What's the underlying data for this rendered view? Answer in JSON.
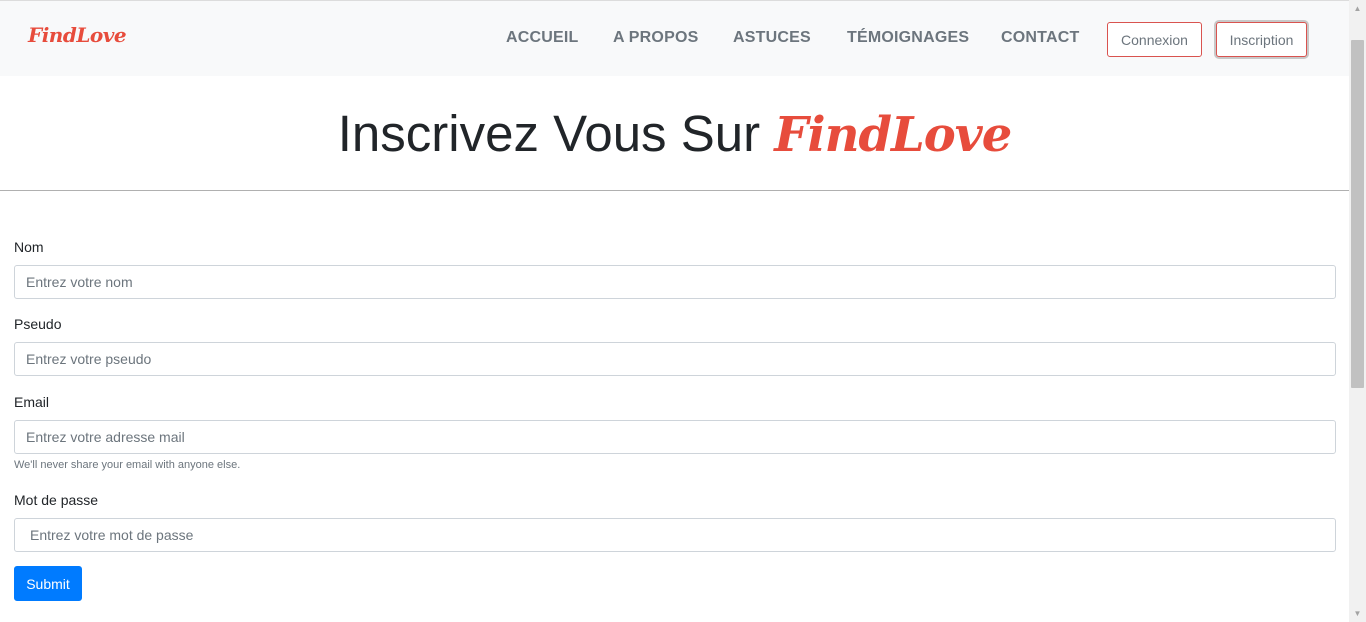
{
  "navbar": {
    "brand": "FindLove",
    "links": [
      "ACCUEIL",
      "A PROPOS",
      "ASTUCES",
      "TÉMOIGNAGES",
      "CONTACT"
    ],
    "login_label": "Connexion",
    "signup_label": "Inscription"
  },
  "hero": {
    "title_prefix": "Inscrivez Vous Sur ",
    "title_brand": "FindLove"
  },
  "form": {
    "name_label": "Nom",
    "name_placeholder": "Entrez votre nom",
    "pseudo_label": "Pseudo",
    "pseudo_placeholder": "Entrez votre pseudo",
    "email_label": "Email",
    "email_placeholder": "Entrez votre adresse mail",
    "email_help": "We'll never share your email with anyone else.",
    "password_label": "Mot de passe",
    "password_placeholder": "Entrez votre mot de passe",
    "submit_label": "Submit"
  },
  "scrollbar": {
    "up_icon": "▲",
    "down_icon": "▼"
  },
  "colors": {
    "brand": "#e74c3c",
    "primary": "#007bff",
    "nav_background": "#f8f9fa"
  }
}
